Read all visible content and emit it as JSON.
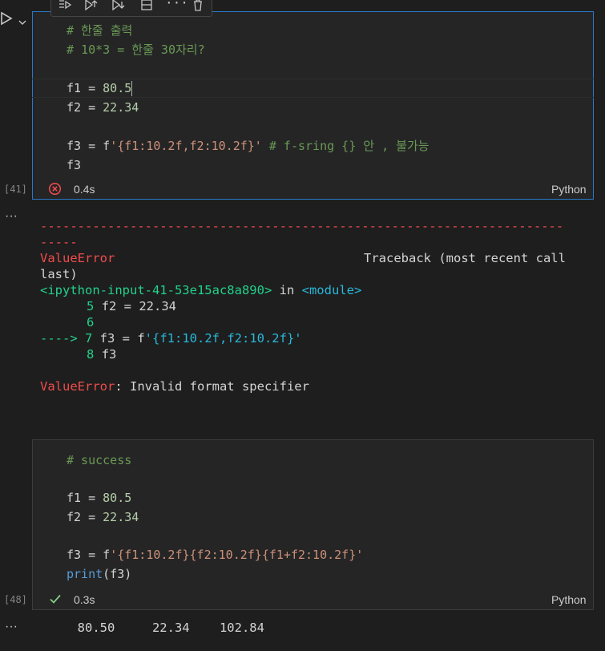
{
  "cell1": {
    "exec_count": "[41]",
    "status_icon": "error-circle-icon",
    "duration": "0.4s",
    "language": "Python",
    "lines": {
      "l1": "# 한줄 출력",
      "l2": "# 10*3 = 한줄 30자리?",
      "l4a": "f1 = ",
      "l4b": "80.5",
      "l5a": "f2 = ",
      "l5b": "22.34",
      "l7a": "f3 = f",
      "l7b": "'{f1:10.2f,f2:10.2f}'",
      "l7c": " # f-sring {} 안 , 불가능",
      "l8": "f3"
    }
  },
  "output1": {
    "dashes1": "----------------------------------------------------------------------",
    "dashes2": "-----",
    "err_name": "ValueError",
    "traceback_label": "Traceback (most recent call",
    "last": "last)",
    "input_ref": "<ipython-input-41-53e15ac8a890>",
    "in_word": " in ",
    "module": "<module>",
    "t5": "5",
    "t5code": "f2 = 22.34",
    "t6": "6",
    "arrow": "----> 7",
    "t7code_a": "f3 = f",
    "t7code_b": "'{f1:10.2f,f2:10.2f}'",
    "t8": "8",
    "t8code": "f3",
    "final_err": "ValueError",
    "final_msg": ": Invalid format specifier"
  },
  "cell2": {
    "exec_count": "[48]",
    "status_icon": "check-icon",
    "duration": "0.3s",
    "language": "Python",
    "lines": {
      "l1": "# success",
      "l3a": "f1 = ",
      "l3b": "80.5",
      "l4a": "f2 = ",
      "l4b": "22.34",
      "l6a": "f3 = f",
      "l6b": "'{f1:10.2f}{f2:10.2f}{f1+f2:10.2f}'",
      "l7a": "print",
      "l7b": "(f3)"
    }
  },
  "output2": {
    "text": "     80.50     22.34    102.84"
  },
  "toolbar": {
    "icons": [
      "run-by-line-icon",
      "execute-above-icon",
      "execute-below-icon",
      "split-cell-icon",
      "more-icon",
      "delete-icon"
    ]
  },
  "colors": {
    "focus_border": "#2a78c8",
    "error": "#f14c4c",
    "success": "#89d185"
  }
}
